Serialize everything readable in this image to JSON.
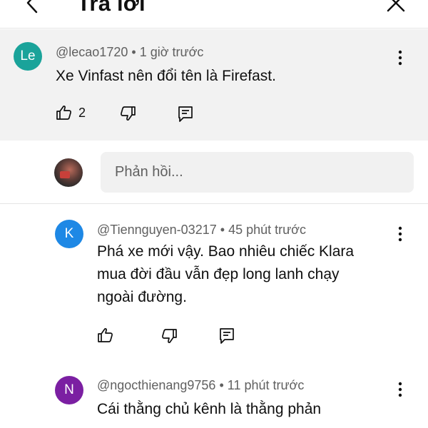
{
  "header": {
    "title": "Trả lời"
  },
  "parent": {
    "avatar_text": "Le",
    "avatar_color": "#1aa39a",
    "handle": "@lecao1720",
    "time": "1 giờ trước",
    "text": "Xe Vinfast nên đổi tên là Firefast.",
    "like_count": "2"
  },
  "reply_box": {
    "placeholder": "Phản hồi..."
  },
  "replies": [
    {
      "avatar_text": "K",
      "avatar_color": "#1e88e5",
      "handle": "@Tiennguyen-03217",
      "time": "45 phút trước",
      "lines": [
        "Phá xe mới vậy. Bao nhiêu chiếc Klara",
        "mua đời đầu vẫn đẹp long lanh chạy",
        "ngoài đường."
      ]
    },
    {
      "avatar_text": "N",
      "avatar_color": "#7b1fa2",
      "handle": "@ngocthienang9756",
      "time": "11 phút trước",
      "lines": [
        "Cái thằng chủ kênh là thằng phản"
      ]
    }
  ],
  "separator": "•"
}
